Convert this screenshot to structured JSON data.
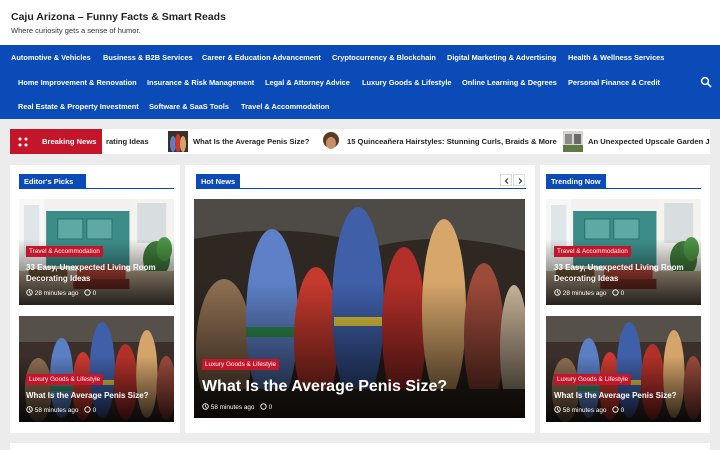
{
  "site": {
    "title": "Caju Arizona – Funny Facts & Smart Reads",
    "tagline": "Where curiosity gets a sense of humor."
  },
  "nav": {
    "items": [
      "Automotive & Vehicles",
      "Business & B2B Services",
      "Career & Education Advancement",
      "Cryptocurrency & Blockchain",
      "Digital Marketing & Advertising",
      "Health & Wellness Services",
      "Home Improvement & Renovation",
      "Insurance & Risk Management",
      "Legal & Attorney Advice",
      "Luxury Goods & Lifestyle",
      "Online Learning & Degrees",
      "Personal Finance & Credit",
      "Real Estate & Property Investment",
      "Software & SaaS Tools",
      "Travel & Accommodation"
    ],
    "search_icon": "search-icon"
  },
  "breaking": {
    "label": "Breaking News",
    "items": [
      "rating Ideas",
      "What Is the Average Penis Size?",
      "15 Quinceañera Hairstyles: Stunning Curls, Braids & More",
      "An Unexpected Upscale Garden Ju"
    ]
  },
  "editors_picks": {
    "heading": "Editor's Picks",
    "cards": [
      {
        "category": "Travel & Accommodation",
        "title": "33 Easy, Unexpected Living Room Decorating Ideas",
        "time": "28 minutes ago",
        "comments": "0"
      },
      {
        "category": "Luxury Goods & Lifestyle",
        "title": "What Is the Average Penis Size?",
        "time": "58 minutes ago",
        "comments": "0"
      }
    ]
  },
  "hot_news": {
    "heading": "Hot News",
    "card": {
      "category": "Luxury Goods & Lifestyle",
      "title": "What Is the Average Penis Size?",
      "time": "58 minutes ago",
      "comments": "0"
    }
  },
  "trending_now": {
    "heading": "Trending Now",
    "cards": [
      {
        "category": "Travel & Accommodation",
        "title": "33 Easy, Unexpected Living Room Decorating Ideas",
        "time": "28 minutes ago",
        "comments": "0"
      },
      {
        "category": "Luxury Goods & Lifestyle",
        "title": "What Is the Average Penis Size?",
        "time": "58 minutes ago",
        "comments": "0"
      }
    ]
  },
  "colors": {
    "brand_blue": "#0a4bb8",
    "accent_red": "#c4162a"
  }
}
